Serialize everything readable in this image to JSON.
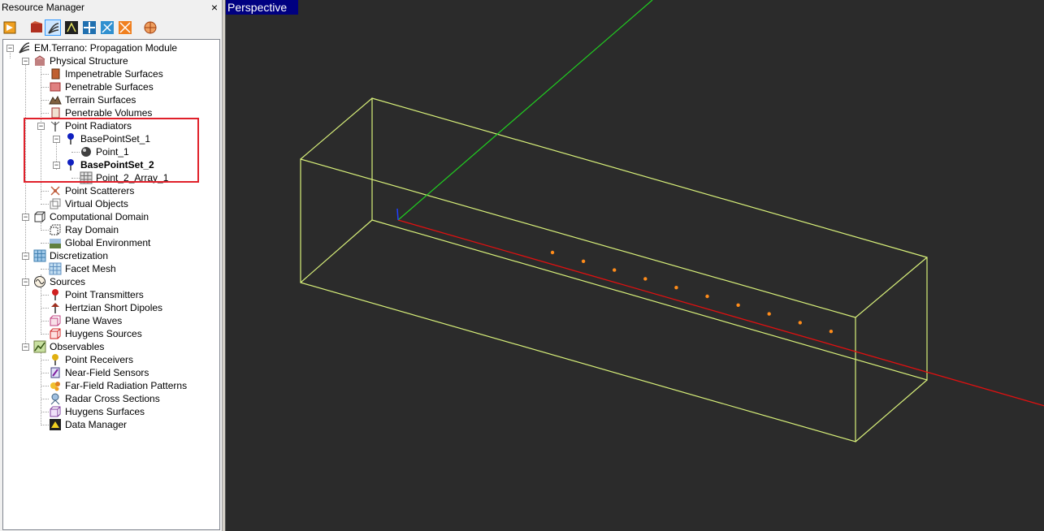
{
  "panel": {
    "title": "Resource Manager",
    "close": "×"
  },
  "toolbar": {
    "icons": [
      "project-icon",
      "physical-structure-icon",
      "propagation-module-icon",
      "antenna-icon",
      "network-icon",
      "radar-icon",
      "transmitter-icon",
      "pattern-icon"
    ],
    "selected_index": 2
  },
  "tree": {
    "root": "EM.Terrano: Propagation Module",
    "physical_structure": "Physical Structure",
    "impenetrable_surfaces": "Impenetrable Surfaces",
    "penetrable_surfaces": "Penetrable Surfaces",
    "terrain_surfaces": "Terrain Surfaces",
    "penetrable_volumes": "Penetrable Volumes",
    "point_radiators": "Point Radiators",
    "basepointset_1": "BasePointSet_1",
    "point_1": "Point_1",
    "basepointset_2": "BasePointSet_2",
    "point_2_array_1": "Point_2_Array_1",
    "point_scatterers": "Point Scatterers",
    "virtual_objects": "Virtual Objects",
    "computational_domain": "Computational Domain",
    "ray_domain": "Ray Domain",
    "global_environment": "Global Environment",
    "discretization": "Discretization",
    "facet_mesh": "Facet Mesh",
    "sources": "Sources",
    "point_transmitters": "Point Transmitters",
    "hertzian_short_dipoles": "Hertzian Short Dipoles",
    "plane_waves": "Plane Waves",
    "huygens_sources": "Huygens Sources",
    "observables": "Observables",
    "point_receivers": "Point Receivers",
    "near_field_sensors": "Near-Field Sensors",
    "far_field_radiation_patterns": "Far-Field Radiation Patterns",
    "radar_cross_sections": "Radar Cross Sections",
    "huygens_surfaces": "Huygens Surfaces",
    "data_manager": "Data Manager"
  },
  "viewport": {
    "label": "Perspective",
    "colors": {
      "background": "#2b2b2b",
      "box": "#d8f07a",
      "x_axis": "#e01010",
      "y_axis": "#20d020",
      "z_axis": "#2040ff",
      "points": "#ff8c1a",
      "highlight": "#e0202a"
    },
    "point_count": 10
  }
}
